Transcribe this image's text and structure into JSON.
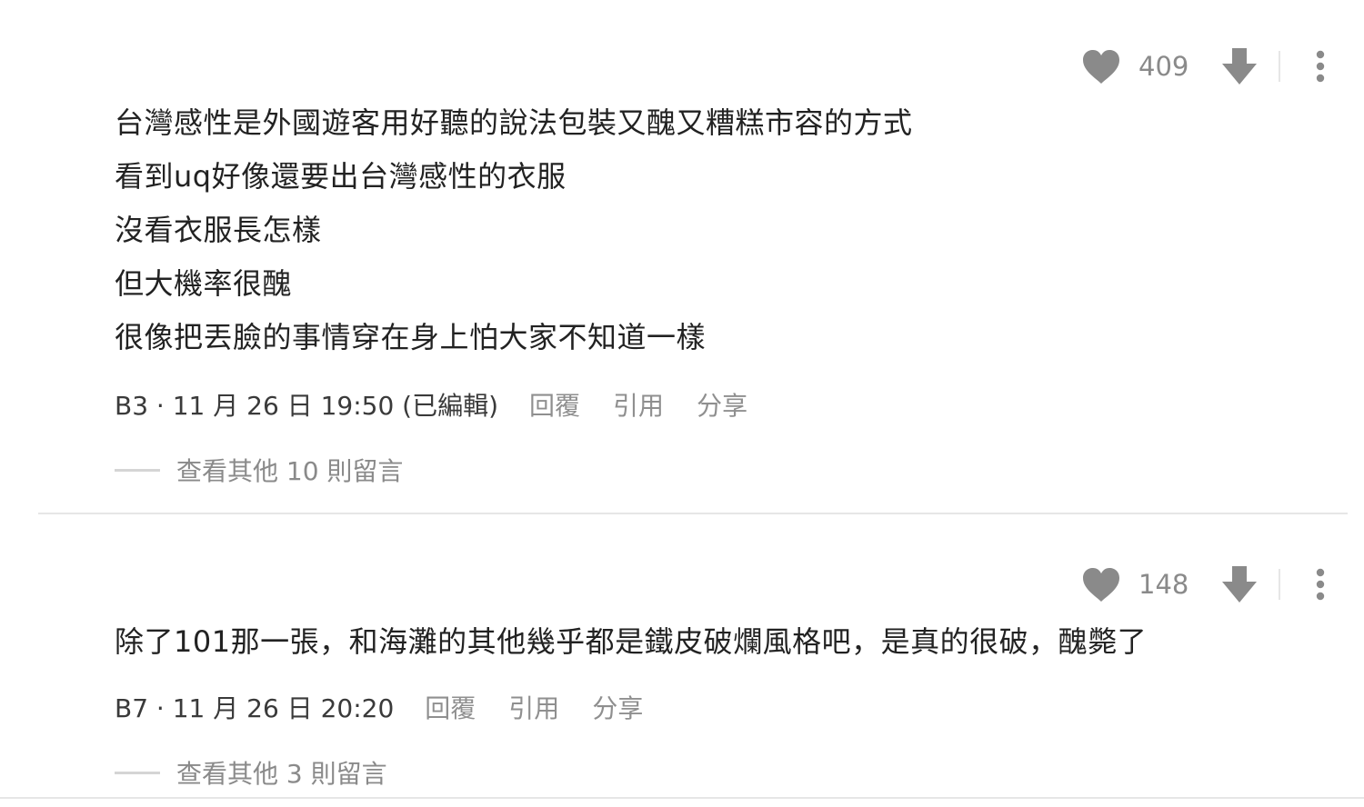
{
  "comments": [
    {
      "likes": "409",
      "lines": [
        "台灣感性是外國遊客用好聽的說法包裝又醜又糟糕市容的方式",
        "看到uq好像還要出台灣感性的衣服",
        "沒看衣服長怎樣",
        "但大機率很醜",
        "很像把丟臉的事情穿在身上怕大家不知道一樣"
      ],
      "meta": "B3 · 11 月 26 日 19:50 (已編輯)",
      "reply_label": "回覆",
      "quote_label": "引用",
      "share_label": "分享",
      "more_replies": "查看其他 10 則留言"
    },
    {
      "likes": "148",
      "lines": [
        "除了101那一張，和海灘的其他幾乎都是鐵皮破爛風格吧，是真的很破，醜斃了"
      ],
      "meta": "B7 · 11 月 26 日 20:20",
      "reply_label": "回覆",
      "quote_label": "引用",
      "share_label": "分享",
      "more_replies": "查看其他 3 則留言"
    }
  ],
  "icons": {
    "like": "heart-icon",
    "dislike": "arrow-down-icon",
    "more": "vertical-dots-icon"
  },
  "colors": {
    "icon_gray": "#8a8a8a",
    "text": "#222222",
    "meta_text": "#3a3a3a",
    "action_text": "#8f8f8f",
    "divider": "#e6e6e6"
  }
}
